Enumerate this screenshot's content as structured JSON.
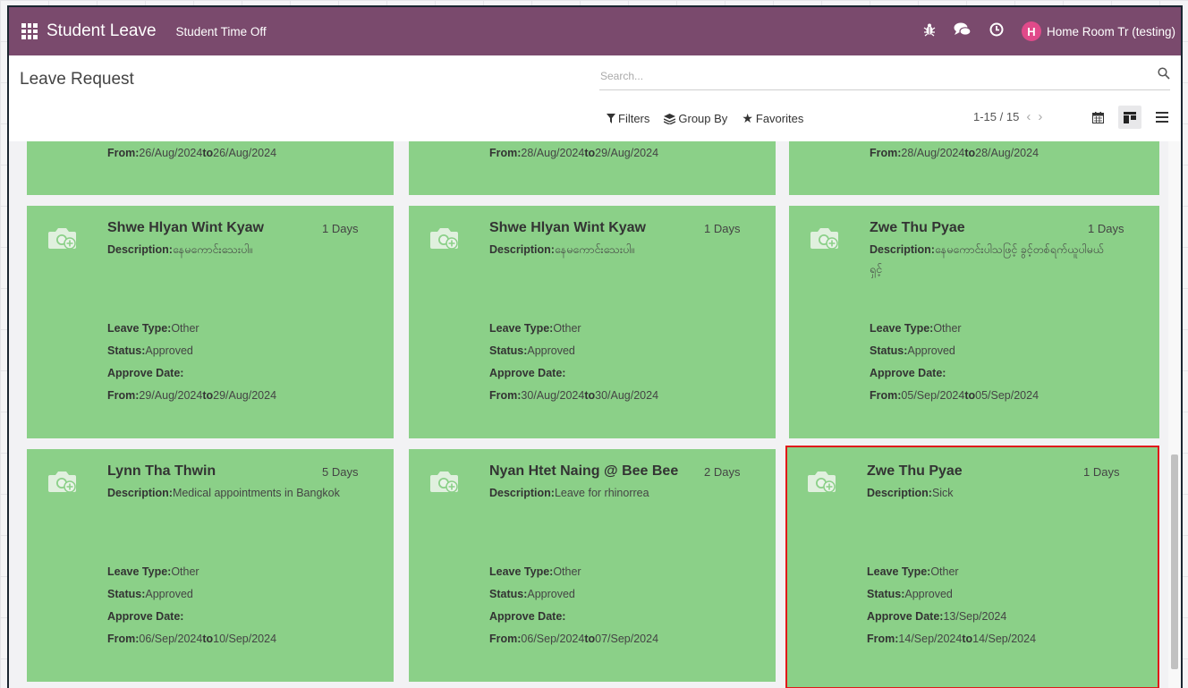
{
  "topbar": {
    "app_name": "Student Leave",
    "menu": "Student Time Off",
    "icons": [
      "bug-icon",
      "chat-icon",
      "clock-icon"
    ],
    "user_initial": "H",
    "user_name": "Home Room Tr (testing)"
  },
  "control": {
    "title": "Leave Request",
    "search_placeholder": "Search...",
    "filters": "Filters",
    "group_by": "Group By",
    "favorites": "Favorites",
    "pager": "1-15 / 15"
  },
  "labels": {
    "description": "Description:",
    "leave_type": "Leave Type:",
    "status": "Status:",
    "approve_date": "Approve Date:",
    "from": "From:",
    "to": "to"
  },
  "top_cards": [
    {
      "from": "26/Aug/2024",
      "to": "26/Aug/2024"
    },
    {
      "from": "28/Aug/2024",
      "to": "29/Aug/2024"
    },
    {
      "from": "28/Aug/2024",
      "to": "28/Aug/2024"
    }
  ],
  "cards": [
    {
      "name": "Shwe Hlyan Wint Kyaw",
      "days": "1 Days",
      "description": "နေမကောင်းသေးပါ။",
      "description2": "",
      "leave_type": "Other",
      "status": "Approved",
      "approve_date": "",
      "from": "29/Aug/2024",
      "to": "29/Aug/2024"
    },
    {
      "name": "Shwe Hlyan Wint Kyaw",
      "days": "1 Days",
      "description": "နေမကောင်းသေးပါ။",
      "description2": "",
      "leave_type": "Other",
      "status": "Approved",
      "approve_date": "",
      "from": "30/Aug/2024",
      "to": "30/Aug/2024"
    },
    {
      "name": "Zwe Thu Pyae",
      "days": "1 Days",
      "description": "နေမကောင်းပါသဖြင့် ခွင့်တစ်ရက်ယူပါမယ်",
      "description2": "ရှင့်",
      "leave_type": "Other",
      "status": "Approved",
      "approve_date": "",
      "from": "05/Sep/2024",
      "to": "05/Sep/2024"
    },
    {
      "name": "Lynn Tha Thwin",
      "days": "5 Days",
      "description": "Medical appointments in Bangkok",
      "description2": "",
      "leave_type": "Other",
      "status": "Approved",
      "approve_date": "",
      "from": "06/Sep/2024",
      "to": "10/Sep/2024"
    },
    {
      "name": "Nyan Htet Naing @ Bee Bee",
      "days": "2 Days",
      "description": "Leave for rhinorrea",
      "description2": "",
      "leave_type": "Other",
      "status": "Approved",
      "approve_date": "",
      "from": "06/Sep/2024",
      "to": "07/Sep/2024"
    },
    {
      "name": "Zwe Thu Pyae",
      "days": "1 Days",
      "description": "Sick",
      "description2": "",
      "leave_type": "Other",
      "status": "Approved",
      "approve_date": "13/Sep/2024",
      "from": "14/Sep/2024",
      "to": "14/Sep/2024"
    }
  ],
  "colors": {
    "topbar": "#7a4a6d",
    "card": "#8bd088",
    "selected_border": "#e01a1a",
    "avatar": "#e04a8a"
  }
}
